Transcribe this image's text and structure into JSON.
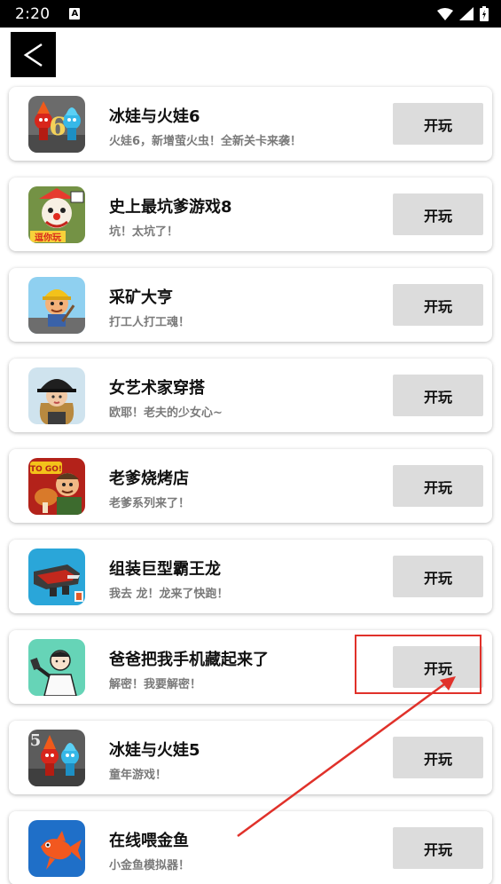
{
  "status_bar": {
    "time": "2:20",
    "notification_icon": "a-icon"
  },
  "header": {
    "back_icon": "back-arrow-icon"
  },
  "games": [
    {
      "title": "冰娃与火娃6",
      "subtitle": "火娃6，新增萤火虫！全新关卡来袭！",
      "button": "开玩"
    },
    {
      "title": "史上最坑爹游戏8",
      "subtitle": "坑！太坑了！",
      "button": "开玩"
    },
    {
      "title": "采矿大亨",
      "subtitle": "打工人打工魂！",
      "button": "开玩"
    },
    {
      "title": "女艺术家穿搭",
      "subtitle": "欧耶！老夫的少女心~",
      "button": "开玩"
    },
    {
      "title": "老爹烧烤店",
      "subtitle": "老爹系列来了！",
      "button": "开玩"
    },
    {
      "title": "组装巨型霸王龙",
      "subtitle": "我去 龙！龙来了快跑！",
      "button": "开玩"
    },
    {
      "title": "爸爸把我手机藏起来了",
      "subtitle": "解密！我要解密！",
      "button": "开玩"
    },
    {
      "title": "冰娃与火娃5",
      "subtitle": "童年游戏！",
      "button": "开玩"
    },
    {
      "title": "在线喂金鱼",
      "subtitle": "小金鱼模拟器！",
      "button": "开玩"
    }
  ],
  "icon_text": {
    "fireboy6_number": "6",
    "trollface_badge": "逗你玩",
    "papa_logo": "TO GO!",
    "fireboy5_number": "5"
  },
  "colors": {
    "play_button_bg": "#dcdcdc",
    "annotation": "#e0312a",
    "subtitle": "#7a7a7a"
  }
}
